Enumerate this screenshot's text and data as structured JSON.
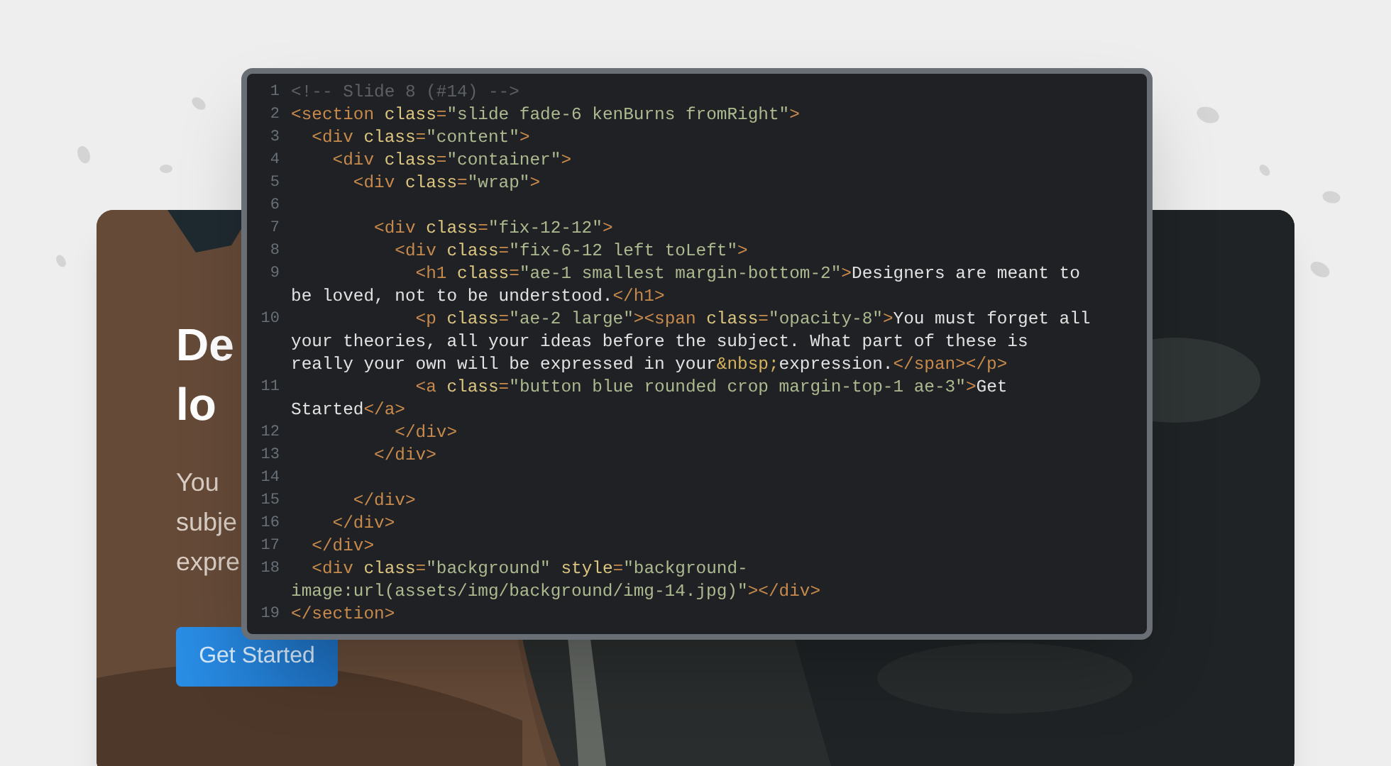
{
  "slide": {
    "kind": "picture",
    "heading_lines": [
      "De",
      "lo"
    ],
    "paragraph_lines": [
      "You",
      "subje",
      "expre"
    ],
    "button": "Get Started"
  },
  "code": {
    "lines": [
      {
        "number": "1",
        "rows": [
          {
            "segments": [
              {
                "kind": "comment",
                "text": "<!-- Slide 8 (#14) -->"
              }
            ]
          }
        ]
      },
      {
        "number": "2",
        "rows": [
          {
            "segments": [
              {
                "kind": "tag",
                "text": "<section"
              },
              {
                "kind": "attr",
                "text": " class"
              },
              {
                "kind": "tag",
                "text": "="
              },
              {
                "kind": "string",
                "text": "\"slide fade-6 kenBurns fromRight\""
              },
              {
                "kind": "tag",
                "text": ">"
              }
            ]
          }
        ]
      },
      {
        "number": "3",
        "rows": [
          {
            "segments": [
              {
                "kind": "tag",
                "text": "  <div"
              },
              {
                "kind": "attr",
                "text": " class"
              },
              {
                "kind": "tag",
                "text": "="
              },
              {
                "kind": "string",
                "text": "\"content\""
              },
              {
                "kind": "tag",
                "text": ">"
              }
            ]
          }
        ]
      },
      {
        "number": "4",
        "rows": [
          {
            "segments": [
              {
                "kind": "tag",
                "text": "    <div"
              },
              {
                "kind": "attr",
                "text": " class"
              },
              {
                "kind": "tag",
                "text": "="
              },
              {
                "kind": "string",
                "text": "\"container\""
              },
              {
                "kind": "tag",
                "text": ">"
              }
            ]
          }
        ]
      },
      {
        "number": "5",
        "rows": [
          {
            "segments": [
              {
                "kind": "tag",
                "text": "      <div"
              },
              {
                "kind": "attr",
                "text": " class"
              },
              {
                "kind": "tag",
                "text": "="
              },
              {
                "kind": "string",
                "text": "\"wrap\""
              },
              {
                "kind": "tag",
                "text": ">"
              }
            ]
          }
        ]
      },
      {
        "number": "6"
      },
      {
        "number": "7",
        "rows": [
          {
            "segments": [
              {
                "kind": "tag",
                "text": "        <div"
              },
              {
                "kind": "attr",
                "text": " class"
              },
              {
                "kind": "tag",
                "text": "="
              },
              {
                "kind": "string",
                "text": "\"fix-12-12\""
              },
              {
                "kind": "tag",
                "text": ">"
              }
            ]
          }
        ]
      },
      {
        "number": "8",
        "rows": [
          {
            "segments": [
              {
                "kind": "tag",
                "text": "          <div"
              },
              {
                "kind": "attr",
                "text": " class"
              },
              {
                "kind": "tag",
                "text": "="
              },
              {
                "kind": "string",
                "text": "\"fix-6-12 left toLeft\""
              },
              {
                "kind": "tag",
                "text": ">"
              }
            ]
          }
        ]
      },
      {
        "number": "9",
        "rows": [
          {
            "segments": [
              {
                "kind": "tag",
                "text": "            <h1"
              },
              {
                "kind": "attr",
                "text": " class"
              },
              {
                "kind": "tag",
                "text": "="
              },
              {
                "kind": "string",
                "text": "\"ae-1 smallest margin-bottom-2\""
              },
              {
                "kind": "tag",
                "text": ">"
              },
              {
                "kind": "text",
                "text": "Designers are meant to"
              }
            ]
          },
          {
            "segments": [
              {
                "kind": "text",
                "text": "be loved, not to be understood."
              },
              {
                "kind": "tag",
                "text": "</h1>"
              }
            ]
          }
        ]
      },
      {
        "number": "10",
        "rows": [
          {
            "segments": [
              {
                "kind": "tag",
                "text": "            <p"
              },
              {
                "kind": "attr",
                "text": " class"
              },
              {
                "kind": "tag",
                "text": "="
              },
              {
                "kind": "string",
                "text": "\"ae-2 large\""
              },
              {
                "kind": "tag",
                "text": "><span"
              },
              {
                "kind": "attr",
                "text": " class"
              },
              {
                "kind": "tag",
                "text": "="
              },
              {
                "kind": "string",
                "text": "\"opacity-8\""
              },
              {
                "kind": "tag",
                "text": ">"
              },
              {
                "kind": "text",
                "text": "You must forget all"
              }
            ]
          },
          {
            "segments": [
              {
                "kind": "text",
                "text": "your theories, all your ideas before the subject. What part of these is"
              }
            ]
          },
          {
            "segments": [
              {
                "kind": "text",
                "text": "really your own will be expressed in your"
              },
              {
                "kind": "entity",
                "text": "&nbsp;"
              },
              {
                "kind": "text",
                "text": "expression."
              },
              {
                "kind": "tag",
                "text": "</span></p>"
              }
            ]
          }
        ]
      },
      {
        "number": "11",
        "rows": [
          {
            "segments": [
              {
                "kind": "tag",
                "text": "            <a"
              },
              {
                "kind": "attr",
                "text": " class"
              },
              {
                "kind": "tag",
                "text": "="
              },
              {
                "kind": "string",
                "text": "\"button blue rounded crop margin-top-1 ae-3\""
              },
              {
                "kind": "tag",
                "text": ">"
              },
              {
                "kind": "text",
                "text": "Get"
              }
            ]
          },
          {
            "segments": [
              {
                "kind": "text",
                "text": "Started"
              },
              {
                "kind": "tag",
                "text": "</a>"
              }
            ]
          }
        ]
      },
      {
        "number": "12",
        "rows": [
          {
            "segments": [
              {
                "kind": "tag",
                "text": "          </div>"
              }
            ]
          }
        ]
      },
      {
        "number": "13",
        "rows": [
          {
            "segments": [
              {
                "kind": "tag",
                "text": "        </div>"
              }
            ]
          }
        ]
      },
      {
        "number": "14"
      },
      {
        "number": "15",
        "rows": [
          {
            "segments": [
              {
                "kind": "tag",
                "text": "      </div>"
              }
            ]
          }
        ]
      },
      {
        "number": "16",
        "rows": [
          {
            "segments": [
              {
                "kind": "tag",
                "text": "    </div>"
              }
            ]
          }
        ]
      },
      {
        "number": "17",
        "rows": [
          {
            "segments": [
              {
                "kind": "tag",
                "text": "  </div>"
              }
            ]
          }
        ]
      },
      {
        "number": "18",
        "rows": [
          {
            "segments": [
              {
                "kind": "tag",
                "text": "  <div"
              },
              {
                "kind": "attr",
                "text": " class"
              },
              {
                "kind": "tag",
                "text": "="
              },
              {
                "kind": "string",
                "text": "\"background\""
              },
              {
                "kind": "attr",
                "text": " style"
              },
              {
                "kind": "tag",
                "text": "="
              },
              {
                "kind": "string",
                "text": "\"background-"
              }
            ]
          },
          {
            "segments": [
              {
                "kind": "string",
                "text": "image:url(assets/img/background/img-14.jpg)\""
              },
              {
                "kind": "tag",
                "text": "></div>"
              }
            ]
          }
        ]
      },
      {
        "number": "19",
        "rows": [
          {
            "segments": [
              {
                "kind": "tag",
                "text": "</section>"
              }
            ]
          }
        ]
      }
    ]
  }
}
